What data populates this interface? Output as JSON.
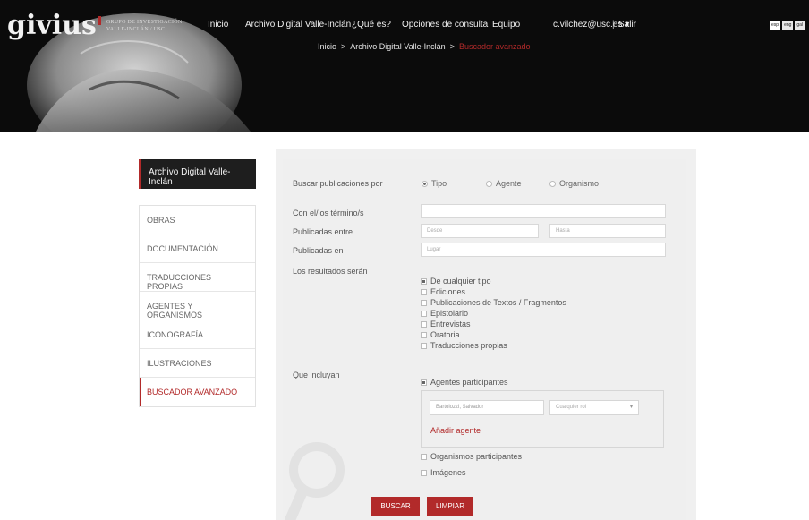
{
  "brand": {
    "logo_text": "givius",
    "subtitle_line1": "GRUPO DE INVESTIGACIÓN",
    "subtitle_line2": "VALLE-INCLÁN / USC"
  },
  "nav": {
    "items": [
      "Inicio",
      "Archivo Digital Valle-Inclán",
      "¿Qué es?",
      "Opciones de consulta",
      "Equipo"
    ],
    "user": "c.vilchez@usc.es",
    "user_caret": "▾",
    "separator": "|",
    "logout": "Salir"
  },
  "languages": [
    "esp",
    "eng",
    "gal"
  ],
  "breadcrumb": {
    "items": [
      "Inicio",
      "Archivo Digital Valle-Inclán"
    ],
    "current": "Buscador avanzado",
    "separator": ">"
  },
  "sidebar": {
    "header": "Archivo Digital Valle-Inclán",
    "items": [
      "OBRAS",
      "DOCUMENTACIÓN",
      "TRADUCCIONES PROPIAS",
      "AGENTES Y ORGANISMOS",
      "ICONOGRAFÍA",
      "ILUSTRACIONES",
      "BUSCADOR AVANZADO"
    ],
    "active_index": 6
  },
  "form": {
    "search_by_label": "Buscar publicaciones por",
    "search_by_options": [
      {
        "label": "Tipo",
        "selected": true
      },
      {
        "label": "Agente",
        "selected": false
      },
      {
        "label": "Organismo",
        "selected": false
      }
    ],
    "terms_label": "Con el/los término/s",
    "terms_value": "",
    "published_between_label": "Publicadas entre",
    "from_placeholder": "Desde",
    "to_placeholder": "Hasta",
    "published_in_label": "Publicadas en",
    "place_placeholder": "Lugar",
    "results_label": "Los resultados serán",
    "result_types": [
      {
        "label": "De cualquier tipo",
        "checked": true
      },
      {
        "label": "Ediciones",
        "checked": false
      },
      {
        "label": "Publicaciones de Textos / Fragmentos",
        "checked": false
      },
      {
        "label": "Epistolario",
        "checked": false
      },
      {
        "label": "Entrevistas",
        "checked": false
      },
      {
        "label": "Oratoria",
        "checked": false
      },
      {
        "label": "Traducciones propias",
        "checked": false
      }
    ],
    "include_label": "Que incluyan",
    "agents_label": "Agentes participantes",
    "agents_checked": true,
    "agent_value": "Bartolozzi, Salvador",
    "role_placeholder": "Cualquier rol",
    "add_agent": "Añadir agente",
    "organisms_label": "Organismos participantes",
    "organisms_checked": false,
    "images_label": "Imágenes",
    "images_checked": false,
    "search_button": "BUSCAR",
    "clear_button": "LIMPIAR"
  },
  "colors": {
    "accent": "#b22a2a",
    "header_bg": "#0b0b0b",
    "panel_bg": "#efefef"
  }
}
